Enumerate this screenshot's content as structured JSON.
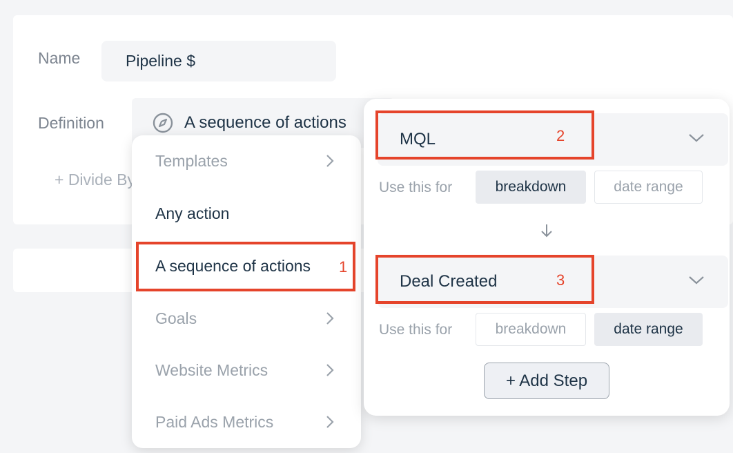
{
  "form": {
    "name_label": "Name",
    "name_value": "Pipeline $",
    "definition_label": "Definition",
    "definition_value": "A sequence of actions",
    "divide_label": "+ Divide By"
  },
  "menu": {
    "items": [
      {
        "label": "Templates",
        "has_submenu": true
      },
      {
        "label": "Any action",
        "has_submenu": false
      },
      {
        "label": "A sequence of actions",
        "has_submenu": false
      },
      {
        "label": "Goals",
        "has_submenu": true
      },
      {
        "label": "Website Metrics",
        "has_submenu": true
      },
      {
        "label": "Paid Ads Metrics",
        "has_submenu": true
      }
    ]
  },
  "annotations": [
    "1",
    "2",
    "3"
  ],
  "steps": [
    {
      "label": "MQL",
      "use_label": "Use this for",
      "options": [
        "breakdown",
        "date range"
      ],
      "selected": "breakdown"
    },
    {
      "label": "Deal Created",
      "use_label": "Use this for",
      "options": [
        "breakdown",
        "date range"
      ],
      "selected": "date range"
    }
  ],
  "add_step_label": "+ Add Step",
  "colors": {
    "annotation": "#e5442b",
    "text_dark": "#1e3346",
    "text_muted": "#9aa2ab",
    "background": "#f4f5f7"
  }
}
